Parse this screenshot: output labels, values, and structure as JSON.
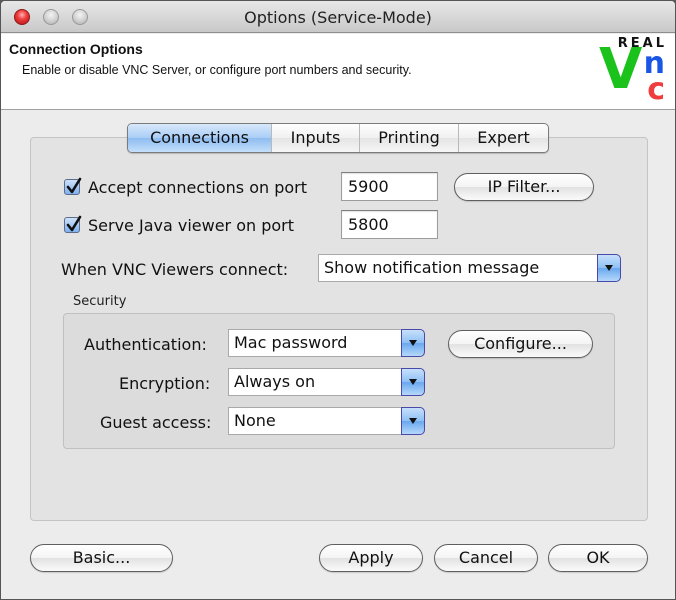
{
  "window": {
    "title": "Options (Service-Mode)",
    "controls": [
      "close",
      "minimize",
      "zoom"
    ]
  },
  "header": {
    "title": "Connection Options",
    "subtitle": "Enable or disable VNC Server, or configure port numbers and security.",
    "logo": {
      "top": "REAL",
      "v": "V",
      "n": "n",
      "c": "c",
      "colors": {
        "v": "#1cc21c",
        "n": "#1a56e6",
        "c": "#f03c3c"
      }
    }
  },
  "tabs": [
    {
      "label": "Connections",
      "active": true
    },
    {
      "label": "Inputs",
      "active": false
    },
    {
      "label": "Printing",
      "active": false
    },
    {
      "label": "Expert",
      "active": false
    }
  ],
  "connections": {
    "accept": {
      "label": "Accept connections on port",
      "checked": true,
      "port": "5900"
    },
    "java": {
      "label": "Serve Java viewer on port",
      "checked": true,
      "port": "5800"
    },
    "ip_filter_label": "IP Filter...",
    "when_connect": {
      "label": "When VNC Viewers connect:",
      "value": "Show notification message"
    }
  },
  "security": {
    "group_label": "Security",
    "authentication": {
      "label": "Authentication:",
      "value": "Mac password"
    },
    "encryption": {
      "label": "Encryption:",
      "value": "Always on"
    },
    "guest": {
      "label": "Guest access:",
      "value": "None"
    },
    "configure_label": "Configure..."
  },
  "footer": {
    "basic_label": "Basic...",
    "apply_label": "Apply",
    "cancel_label": "Cancel",
    "ok_label": "OK"
  }
}
